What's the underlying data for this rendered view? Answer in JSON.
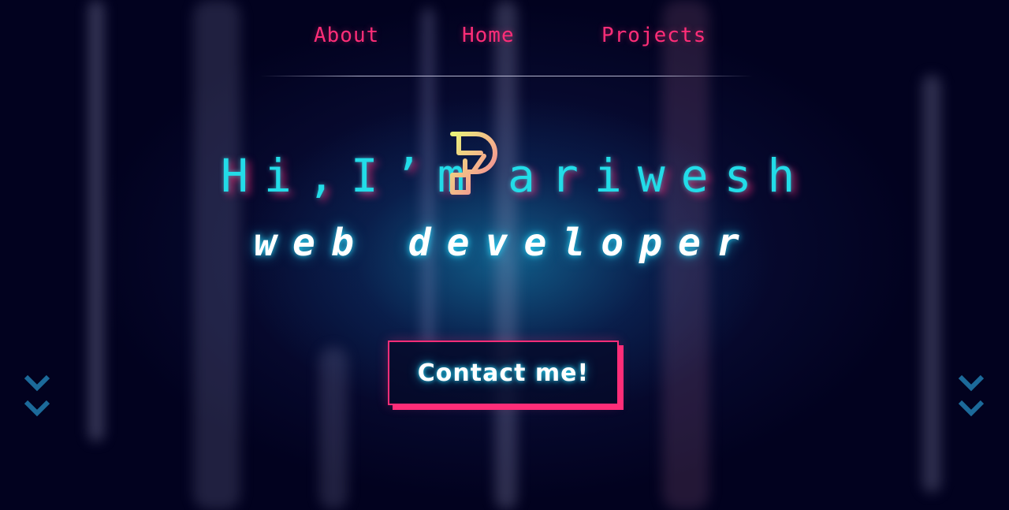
{
  "nav": {
    "links": [
      {
        "label": "About"
      },
      {
        "label": "Home"
      },
      {
        "label": "Projects"
      }
    ]
  },
  "hero": {
    "greeting_prefix": "Hi,I’m",
    "logo_letter": "P",
    "greeting_name_rest": "ariwesh",
    "role": "web developer",
    "contact_label": "Contact me!"
  },
  "icons": {
    "logo": "letter-p-logo-icon",
    "scroll_left": "double-chevron-down-icon",
    "scroll_right": "double-chevron-down-icon"
  },
  "colors": {
    "background": "#02021f",
    "accent_pink": "#ff2d78",
    "accent_cyan": "#22dce8",
    "chevron_blue": "#1c6a9a"
  }
}
